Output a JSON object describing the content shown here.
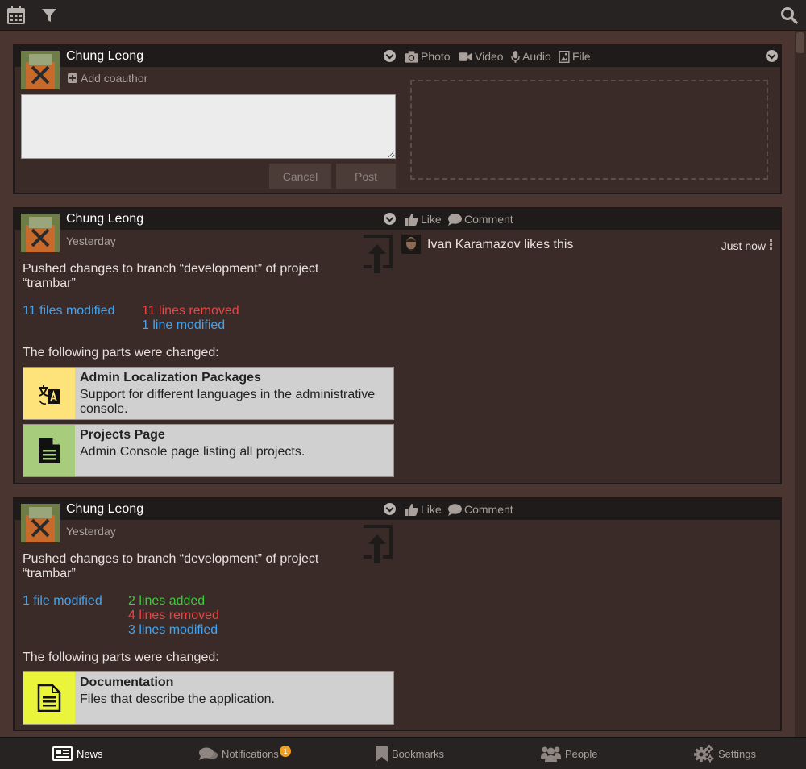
{
  "composer": {
    "author": "Chung Leong",
    "add_coauthor": "Add coauthor",
    "attachments": [
      "Photo",
      "Video",
      "Audio",
      "File"
    ],
    "text_value": "",
    "cancel_label": "Cancel",
    "post_label": "Post"
  },
  "stories": [
    {
      "author": "Chung Leong",
      "date": "Yesterday",
      "actions": [
        "Like",
        "Comment"
      ],
      "message": "Pushed changes to branch “development” of project “trambar”",
      "stats": {
        "files": "11 files modified",
        "lines": [
          "11 lines removed",
          "1 line modified"
        ]
      },
      "parts_label": "The following parts were changed:",
      "parts": [
        {
          "title": "Admin Localization Packages",
          "description": "Support for different languages in the administrative console.",
          "color": "#fde37a",
          "icon": "translate-icon"
        },
        {
          "title": "Projects Page",
          "description": "Admin Console page listing all projects.",
          "color": "#a6cc7c",
          "icon": "document-icon"
        }
      ],
      "reaction": {
        "text": "Ivan Karamazov likes this",
        "time": "Just now"
      }
    },
    {
      "author": "Chung Leong",
      "date": "Yesterday",
      "actions": [
        "Like",
        "Comment"
      ],
      "message": "Pushed changes to branch “development” of project “trambar”",
      "stats": {
        "files": "1 file modified",
        "lines": [
          "2 lines added",
          "4 lines removed",
          "3 lines modified"
        ]
      },
      "parts_label": "The following parts were changed:",
      "parts": [
        {
          "title": "Documentation",
          "description": "Files that describe the application.",
          "color": "#eaf43a",
          "icon": "text-document-icon"
        }
      ]
    }
  ],
  "nav": {
    "items": [
      "News",
      "Notifications",
      "Bookmarks",
      "People",
      "Settings"
    ],
    "notification_count": "1",
    "active": "News"
  },
  "colors": {
    "blue": "#42a3ef",
    "red": "#e94545",
    "green": "#43c743",
    "badge": "#f0a020"
  }
}
